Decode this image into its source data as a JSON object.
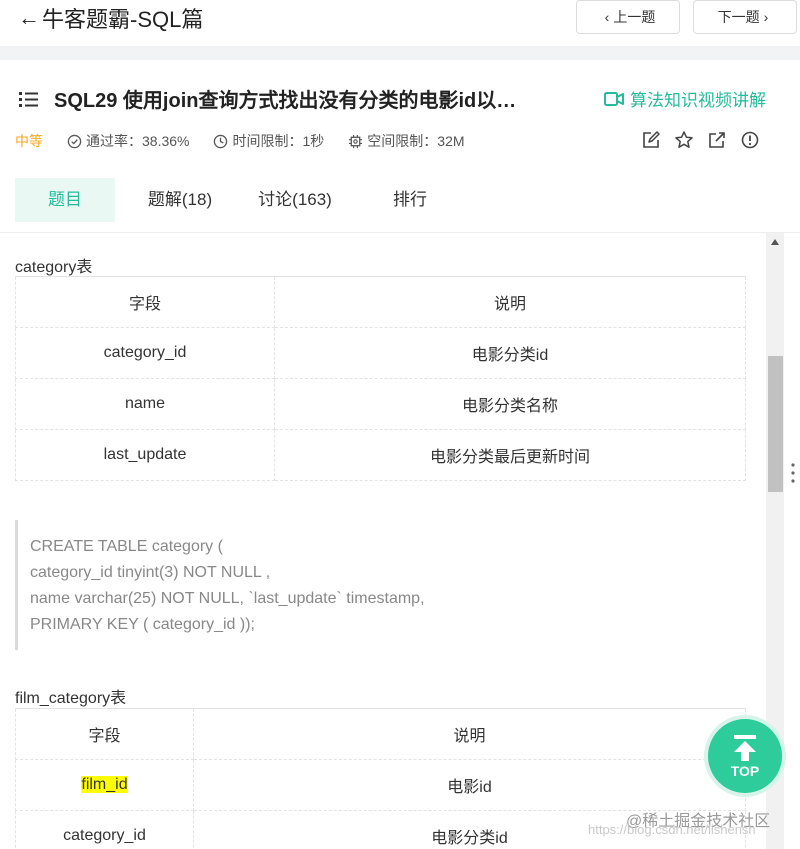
{
  "topbar": {
    "back_label": "牛客题霸-SQL篇",
    "prev_label": "上一题",
    "next_label": "下一题"
  },
  "header": {
    "title": "SQL29  使用join查询方式找出没有分类的电影id以…",
    "video_link": "算法知识视频讲解",
    "difficulty": "中等",
    "pass_rate": "通过率：38.36%",
    "time_limit": "时间限制：1秒",
    "space_limit": "空间限制：32M"
  },
  "tabs": [
    {
      "label": "题目"
    },
    {
      "label": "题解(18)"
    },
    {
      "label": "讨论(163)"
    },
    {
      "label": "排行"
    }
  ],
  "category": {
    "title": "category表",
    "header": [
      "字段",
      "说明"
    ],
    "rows": [
      [
        "category_id",
        "电影分类id"
      ],
      [
        "name",
        "电影分类名称"
      ],
      [
        "last_update",
        "电影分类最后更新时间"
      ]
    ]
  },
  "code": {
    "lines": [
      "CREATE TABLE category  (",
      "category_id  tinyint(3)  NOT NULL ,",
      "name  varchar(25) NOT NULL, `last_update` timestamp,",
      "PRIMARY KEY ( category_id ));"
    ]
  },
  "film_category": {
    "title": "film_category表",
    "header": [
      "字段",
      "说明"
    ],
    "rows": [
      [
        "film_id",
        "电影id"
      ],
      [
        "category_id",
        "电影分类id"
      ]
    ]
  },
  "top_button": {
    "label": "TOP"
  },
  "watermark": {
    "brand": "@稀土掘金技术社区",
    "url": "https://blog.csdn.net/lishensh"
  },
  "colors": {
    "accent": "#25bb9b",
    "difficulty": "#f5a623",
    "highlight": "#ffff00",
    "top_button": "#2ecc9a"
  }
}
